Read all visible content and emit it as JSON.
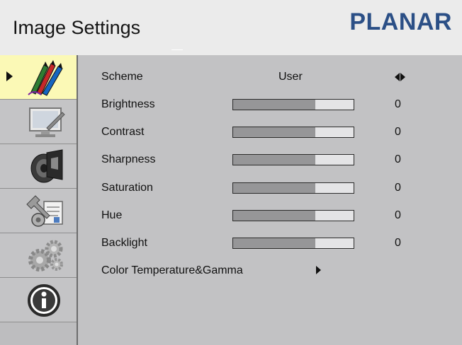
{
  "header": {
    "title": "Image Settings",
    "brand": "PLANAR",
    "brand_color": "#2b4f86"
  },
  "sidebar": {
    "items": [
      {
        "icon": "image-settings-icon",
        "active": true
      },
      {
        "icon": "display-monitor-icon",
        "active": false
      },
      {
        "icon": "audio-speaker-icon",
        "active": false
      },
      {
        "icon": "tools-settings-icon",
        "active": false
      },
      {
        "icon": "gears-icon",
        "active": false
      },
      {
        "icon": "info-icon",
        "active": false
      }
    ],
    "active_color": "#fbf9b6"
  },
  "settings": {
    "scheme": {
      "label": "Scheme",
      "value": "User"
    },
    "brightness": {
      "label": "Brightness",
      "value": "0",
      "level": 0.68
    },
    "contrast": {
      "label": "Contrast",
      "value": "0",
      "level": 0.68
    },
    "sharpness": {
      "label": "Sharpness",
      "value": "0",
      "level": 0.68
    },
    "saturation": {
      "label": "Saturation",
      "value": "0",
      "level": 0.68
    },
    "hue": {
      "label": "Hue",
      "value": "0",
      "level": 0.68
    },
    "backlight": {
      "label": "Backlight",
      "value": "0",
      "level": 0.68
    },
    "color_temperature": {
      "label": "Color Temperature&Gamma"
    }
  }
}
